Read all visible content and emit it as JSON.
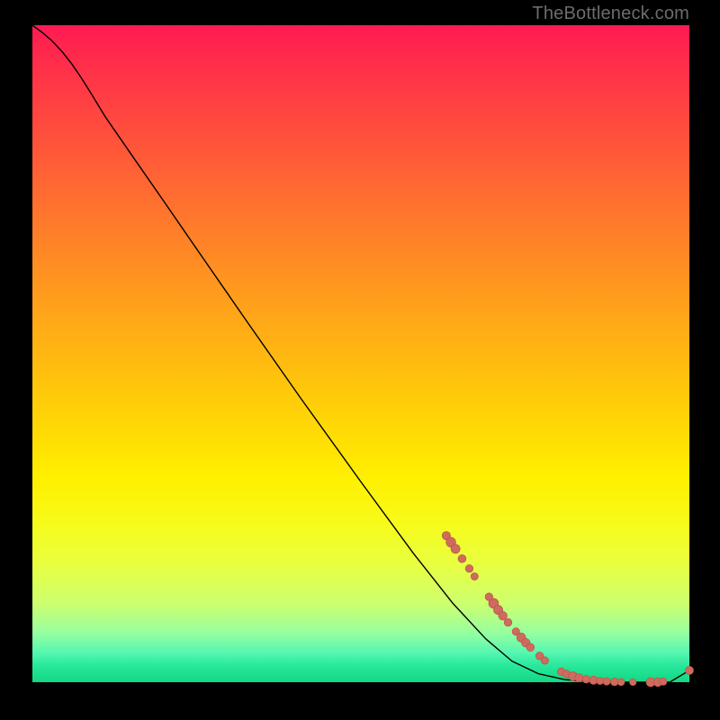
{
  "watermark": "TheBottleneck.com",
  "colors": {
    "page_bg": "#000000",
    "curve_stroke": "#000000",
    "dot_fill": "#cf6a5e",
    "dot_stroke": "#b65146",
    "watermark_text": "#6c6c6c"
  },
  "chart_data": {
    "type": "line",
    "title": "",
    "xlabel": "",
    "ylabel": "",
    "xlim": [
      0,
      100
    ],
    "ylim": [
      0,
      100
    ],
    "grid": false,
    "curve": [
      {
        "x": 0.0,
        "y": 100.0
      },
      {
        "x": 1.5,
        "y": 98.9
      },
      {
        "x": 3.0,
        "y": 97.6
      },
      {
        "x": 4.5,
        "y": 96.0
      },
      {
        "x": 6.0,
        "y": 94.1
      },
      {
        "x": 7.5,
        "y": 91.9
      },
      {
        "x": 9.0,
        "y": 89.5
      },
      {
        "x": 11.0,
        "y": 86.2
      },
      {
        "x": 15.0,
        "y": 80.4
      },
      {
        "x": 20.0,
        "y": 73.2
      },
      {
        "x": 26.0,
        "y": 64.5
      },
      {
        "x": 33.0,
        "y": 54.4
      },
      {
        "x": 41.0,
        "y": 43.0
      },
      {
        "x": 50.0,
        "y": 30.5
      },
      {
        "x": 58.0,
        "y": 19.6
      },
      {
        "x": 64.0,
        "y": 12.0
      },
      {
        "x": 69.0,
        "y": 6.6
      },
      {
        "x": 73.0,
        "y": 3.2
      },
      {
        "x": 77.0,
        "y": 1.3
      },
      {
        "x": 81.0,
        "y": 0.4
      },
      {
        "x": 85.0,
        "y": 0.05
      },
      {
        "x": 89.0,
        "y": 0.0
      },
      {
        "x": 93.0,
        "y": 0.0
      },
      {
        "x": 97.0,
        "y": 0.0
      },
      {
        "x": 100.0,
        "y": 1.8
      }
    ],
    "markers": [
      {
        "x": 63.0,
        "y": 22.3,
        "r": 4.7
      },
      {
        "x": 63.7,
        "y": 21.3,
        "r": 5.4
      },
      {
        "x": 64.4,
        "y": 20.3,
        "r": 5.1
      },
      {
        "x": 65.4,
        "y": 18.8,
        "r": 4.5
      },
      {
        "x": 66.5,
        "y": 17.3,
        "r": 4.3
      },
      {
        "x": 67.3,
        "y": 16.1,
        "r": 4.1
      },
      {
        "x": 69.5,
        "y": 13.0,
        "r": 4.3
      },
      {
        "x": 70.2,
        "y": 12.0,
        "r": 5.5
      },
      {
        "x": 70.9,
        "y": 11.0,
        "r": 5.1
      },
      {
        "x": 71.6,
        "y": 10.1,
        "r": 4.8
      },
      {
        "x": 72.4,
        "y": 9.1,
        "r": 4.3
      },
      {
        "x": 73.6,
        "y": 7.7,
        "r": 4.2
      },
      {
        "x": 74.4,
        "y": 6.8,
        "r": 5.0
      },
      {
        "x": 75.1,
        "y": 6.0,
        "r": 4.8
      },
      {
        "x": 75.8,
        "y": 5.3,
        "r": 4.4
      },
      {
        "x": 77.2,
        "y": 4.0,
        "r": 4.4
      },
      {
        "x": 78.0,
        "y": 3.3,
        "r": 4.2
      },
      {
        "x": 80.5,
        "y": 1.6,
        "r": 4.3
      },
      {
        "x": 81.3,
        "y": 1.25,
        "r": 4.3
      },
      {
        "x": 82.3,
        "y": 0.9,
        "r": 5.0
      },
      {
        "x": 83.2,
        "y": 0.65,
        "r": 4.6
      },
      {
        "x": 84.3,
        "y": 0.45,
        "r": 4.3
      },
      {
        "x": 85.4,
        "y": 0.3,
        "r": 4.6
      },
      {
        "x": 86.4,
        "y": 0.2,
        "r": 4.1
      },
      {
        "x": 87.4,
        "y": 0.12,
        "r": 4.2
      },
      {
        "x": 88.6,
        "y": 0.06,
        "r": 4.4
      },
      {
        "x": 89.6,
        "y": 0.03,
        "r": 4.0
      },
      {
        "x": 91.4,
        "y": 0.01,
        "r": 3.8
      },
      {
        "x": 94.1,
        "y": 0.0,
        "r": 5.0
      },
      {
        "x": 95.2,
        "y": 0.0,
        "r": 4.8
      },
      {
        "x": 96.0,
        "y": 0.1,
        "r": 4.2
      },
      {
        "x": 100.0,
        "y": 1.8,
        "r": 4.6
      }
    ]
  }
}
